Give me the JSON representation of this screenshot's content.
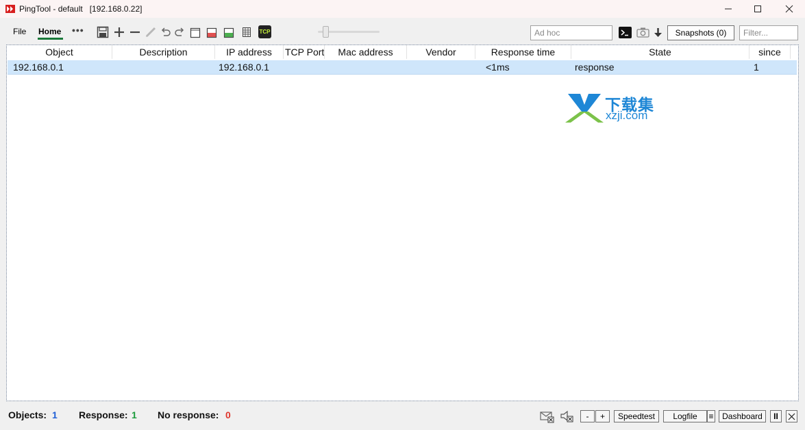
{
  "window": {
    "title": "PingTool - default   [192.168.0.22]",
    "brand_color": "#d81e1e"
  },
  "toolbar": {
    "menu": {
      "file": "File",
      "home": "Home",
      "more": "•••"
    },
    "tool_icons": [
      "save-icon",
      "add-icon",
      "remove-icon",
      "edit-icon",
      "undo-icon",
      "redo-icon",
      "new-document-icon",
      "export-red-icon",
      "export-green-icon",
      "grid-icon",
      "tcp-icon"
    ],
    "tcp_badge": "TCP",
    "adhoc_placeholder": "Ad hoc",
    "snapshots_label": "Snapshots (0)",
    "filter_placeholder": "Filter..."
  },
  "table": {
    "columns": [
      "Object",
      "Description",
      "IP address",
      "TCP Port",
      "Mac address",
      "Vendor",
      "Response time",
      "State",
      "since"
    ],
    "rows": [
      {
        "object": "192.168.0.1",
        "description": "",
        "ip": "192.168.0.1",
        "tcp_port": "",
        "mac": "",
        "vendor": "",
        "response_time": "<1ms",
        "state": "response",
        "since": "1"
      }
    ],
    "selected_row_color": "#cfe6fb"
  },
  "watermark": {
    "cn": "下载集",
    "en": "xzji.com",
    "color": "#1e87d6"
  },
  "status": {
    "objects_label": "Objects:",
    "objects_value": "1",
    "objects_color": "#1f5fd6",
    "response_label": "Response:",
    "response_value": "1",
    "response_color": "#1a9a3a",
    "no_response_label": "No response:",
    "no_response_value": "0",
    "no_response_color": "#e0362c",
    "minus": "-",
    "plus": "+",
    "speedtest": "Speedtest",
    "logfile": "Logfile",
    "menu_glyph": "≡",
    "dashboard": "Dashboard",
    "pause": "II"
  }
}
